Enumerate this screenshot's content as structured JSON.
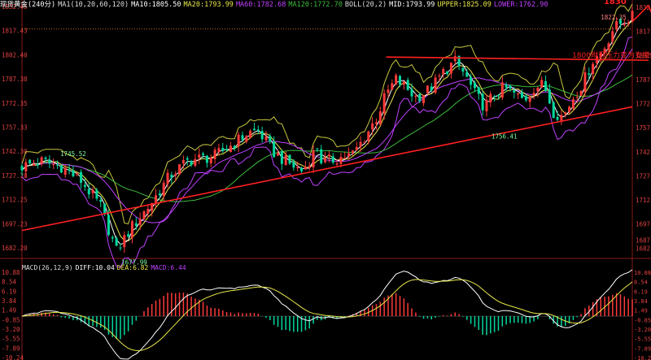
{
  "header": {
    "instrument": "现货黄金(240分)",
    "ma_label": "MA1(10,20,60,120)",
    "ma10": "MA10:1805.50",
    "ma20": "MA20:1793.99",
    "ma60": "MA60:1782.68",
    "ma120": "MA120:1772.70",
    "boll_label": "BOLL(20,2)",
    "boll_mid": "MID:1793.99",
    "boll_upper": "UPPER:1825.09",
    "boll_lower": "LOWER:1762.90"
  },
  "macd_header": {
    "label": "MACD(26,12,9)",
    "diff": "DIFF:10.04",
    "dea": "DEA:6.82",
    "macd": "MACD:6.44"
  },
  "colors": {
    "up": "#ff3a3a",
    "down": "#00d8a0",
    "ma10": "#ffffff",
    "ma20": "#e8e84a",
    "ma60": "#c040ff",
    "ma120": "#3dbb3d",
    "boll": "#c8c840",
    "trend": "#ff2020",
    "axis_text": "#e04040",
    "grid": "#8a1a1a"
  },
  "chart_data": {
    "type": "candlestick",
    "main": {
      "ylim": [
        1682.2,
        1832.45
      ],
      "left_ticks": [
        "1832.45",
        "1817.43",
        "1802.40",
        "1787.38",
        "1772.35",
        "1757.33",
        "1742.30",
        "1727.28",
        "1712.25",
        "1697.23",
        "1682.20"
      ],
      "right_ticks": [
        "1832",
        "1817",
        "1802",
        "1787",
        "1772",
        "1757",
        "1742",
        "1727",
        "1712",
        "1697",
        "1687",
        "1682"
      ],
      "annotations": [
        {
          "text": "1745.52",
          "x": 34,
          "y": 1745.52,
          "type": "low-label"
        },
        {
          "text": "1677.99",
          "x": 96,
          "y": 1677.99,
          "type": "low-label"
        },
        {
          "text": "1756.41",
          "x": 472,
          "y": 1756.41,
          "type": "low-label"
        },
        {
          "text": "1822.35",
          "x": 588,
          "y": 1822.35,
          "type": "high-label"
        },
        {
          "text": "1830",
          "x": 596,
          "y": 1830,
          "type": "target"
        },
        {
          "text": "1800附近压力变为支撑位",
          "x": 420,
          "y": 1799,
          "type": "note"
        }
      ],
      "resistance_line": {
        "from": [
          370,
          1801
        ],
        "to": [
          620,
          1799
        ]
      },
      "trend_line": {
        "from": [
          0,
          1693
        ],
        "to": [
          620,
          1770
        ]
      },
      "resistance_level": 1818.5
    },
    "macd": {
      "ylim": [
        -10.24,
        10.88
      ],
      "left_ticks": [
        "10.88",
        "8.54",
        "6.19",
        "3.84",
        "1.49",
        "-0.85",
        "-3.20",
        "-5.55",
        "-7.89",
        "-10.24"
      ],
      "right_ticks": [
        "10.88",
        "8.54",
        "6.19",
        "3.84",
        "1.49",
        "-0.85",
        "-3.20",
        "-5.55",
        "-7.89",
        "-10.24"
      ]
    }
  }
}
